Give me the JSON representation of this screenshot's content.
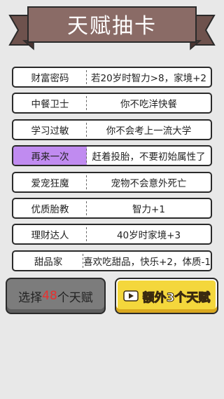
{
  "header": {
    "title": "天赋抽卡"
  },
  "talents": [
    {
      "name": "财富密码",
      "desc": "若20岁时智力>8，家境+2",
      "selected": false
    },
    {
      "name": "中餐卫士",
      "desc": "你不吃洋快餐",
      "selected": false
    },
    {
      "name": "学习过敏",
      "desc": "你不会考上一流大学",
      "selected": false
    },
    {
      "name": "再来一次",
      "desc": "赶着投胎，不要初始属性了",
      "selected": true
    },
    {
      "name": "爱宠狂魔",
      "desc": "宠物不会意外死亡",
      "selected": false
    },
    {
      "name": "优质胎教",
      "desc": "智力+1",
      "selected": false
    },
    {
      "name": "理财达人",
      "desc": "40岁时家境+3",
      "selected": false
    },
    {
      "name": "甜品家",
      "desc": "喜欢吃甜品，快乐+2，体质-1",
      "selected": false
    }
  ],
  "buttons": {
    "choose": {
      "prefix": "选择",
      "count": "48",
      "suffix": "个天赋"
    },
    "extra": {
      "label": "额外3个天赋",
      "icon": "video-ad-icon"
    }
  },
  "colors": {
    "background": "#e8e8e8",
    "banner": "#8a6b66",
    "selected": "#c08bf0",
    "count_highlight": "#e8302f",
    "extra_button": "#f4d73c"
  }
}
